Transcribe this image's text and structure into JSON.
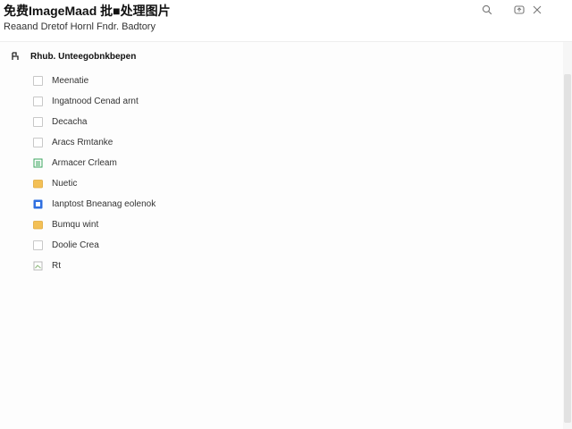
{
  "window": {
    "title": "免费ImageMaad 批■处理图片",
    "subtitle": "Reaand Dretof Hornl Fndr. Badtory"
  },
  "toolbar": {
    "icons": [
      "search-icon",
      "refresh-icon",
      "close-icon"
    ]
  },
  "tree": {
    "root_label": "Rhub. Unteegobnkbepen",
    "items": [
      {
        "label": "Meenatie",
        "icon": "checkbox"
      },
      {
        "label": "Ingatnood Cenad arnt",
        "icon": "checkbox"
      },
      {
        "label": "Decacha",
        "icon": "checkbox"
      },
      {
        "label": "Aracs Rmtanke",
        "icon": "checkbox"
      },
      {
        "label": "Armacer Crleam",
        "icon": "sheet-file-icon"
      },
      {
        "label": "Nuetic",
        "icon": "folder-icon"
      },
      {
        "label": "Ianptost Bneanag eolenok",
        "icon": "doc-file-icon"
      },
      {
        "label": "Bumqu wint",
        "icon": "folder-icon"
      },
      {
        "label": "Doolie Crea",
        "icon": "checkbox"
      },
      {
        "label": "Rt",
        "icon": "image-file-icon"
      }
    ]
  },
  "colors": {
    "accent_blue": "#2f6fe0",
    "folder_yellow": "#f3c056",
    "sheet_green": "#3aa55d"
  }
}
